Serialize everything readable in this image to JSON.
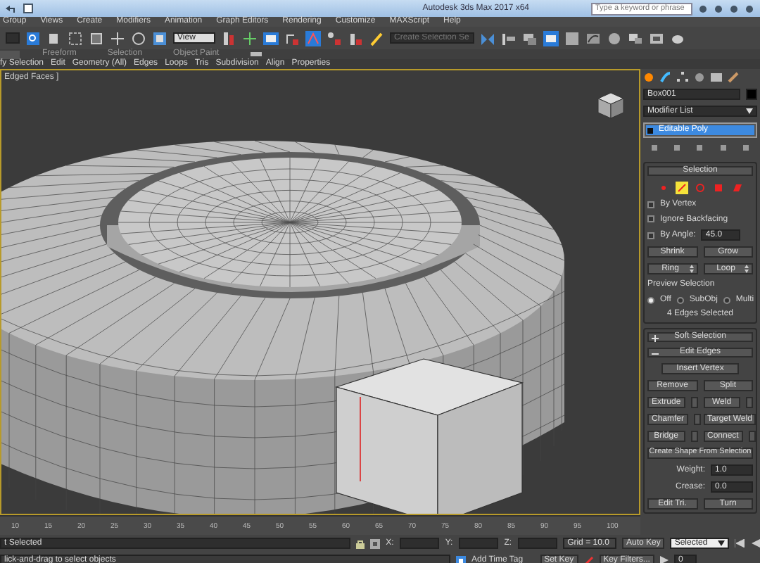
{
  "window": {
    "title": "Autodesk 3ds Max 2017 x64",
    "search_placeholder": "Type a keyword or phrase"
  },
  "menu": [
    "Group",
    "Views",
    "Create",
    "Modifiers",
    "Animation",
    "Graph Editors",
    "Rendering",
    "Customize",
    "MAXScript",
    "Help"
  ],
  "toolbar": {
    "view_dropdown": "View",
    "selection_set_placeholder": "Create Selection Se"
  },
  "ribbon_tabs": [
    {
      "label": "Freeform",
      "selected": false
    },
    {
      "label": "Selection",
      "selected": false
    },
    {
      "label": "Object Paint",
      "selected": false
    }
  ],
  "ribbon_panels": [
    "fy Selection",
    "Edit",
    "Geometry (All)",
    "Edges",
    "Loops",
    "Tris",
    "Subdivision",
    "Align",
    "Properties"
  ],
  "viewport": {
    "label": "Edged Faces ]"
  },
  "command_panel": {
    "object_name": "Box001",
    "modifier_list": "Modifier List",
    "stack": [
      {
        "label": "Editable Poly",
        "selected": true
      }
    ],
    "selection": {
      "title": "Selection",
      "subobject_levels": [
        {
          "kind": "vertex",
          "selected": false
        },
        {
          "kind": "edge",
          "selected": true
        },
        {
          "kind": "border",
          "selected": false
        },
        {
          "kind": "polygon",
          "selected": false
        },
        {
          "kind": "element",
          "selected": false
        }
      ],
      "checkboxes": [
        {
          "label": "By Vertex",
          "checked": false
        },
        {
          "label": "Ignore Backfacing",
          "checked": false
        },
        {
          "label": "By Angle:",
          "checked": false,
          "value": "45.0"
        }
      ],
      "buttons": [
        {
          "label": "Shrink",
          "kind": "plain"
        },
        {
          "label": "Grow",
          "kind": "plain"
        },
        {
          "label": "Ring",
          "kind": "spinner"
        },
        {
          "label": "Loop",
          "kind": "spinner"
        }
      ],
      "preview_title": "Preview Selection",
      "preview_options": [
        {
          "label": "Off",
          "selected": true
        },
        {
          "label": "SubObj",
          "selected": false
        },
        {
          "label": "Multi",
          "selected": false
        }
      ],
      "status": "4 Edges Selected"
    },
    "rollouts": [
      {
        "label": "Soft Selection",
        "expanded": false
      },
      {
        "label": "Edit Edges",
        "expanded": true
      }
    ],
    "edit_edges": {
      "insert": "Insert Vertex",
      "buttons": [
        {
          "label": "Remove",
          "settings": false
        },
        {
          "label": "Split",
          "settings": false
        },
        {
          "label": "Extrude",
          "settings": true
        },
        {
          "label": "Weld",
          "settings": true
        },
        {
          "label": "Chamfer",
          "settings": true
        },
        {
          "label": "Target Weld",
          "settings": false
        },
        {
          "label": "Bridge",
          "settings": true
        },
        {
          "label": "Connect",
          "settings": true
        }
      ],
      "create_shape": "Create Shape From Selection",
      "spinners": [
        {
          "label": "Weight:",
          "value": "1.0"
        },
        {
          "label": "Crease:",
          "value": "0.0"
        }
      ],
      "bottom": [
        "Edit Tri.",
        "Turn"
      ]
    }
  },
  "timeline": {
    "ticks": [
      "10",
      "15",
      "20",
      "25",
      "30",
      "35",
      "40",
      "45",
      "50",
      "55",
      "60",
      "65",
      "70",
      "75",
      "80",
      "85",
      "90",
      "95",
      "100"
    ]
  },
  "status": {
    "selection": "t Selected",
    "prompt": "lick-and-drag to select objects",
    "coords": [
      "X:",
      "Y:",
      "Z:"
    ],
    "grid": "Grid = 10.0",
    "add_time_tag": "Add Time Tag",
    "auto_key": "Auto Key",
    "key_mode": "Selected",
    "set_key": "Set Key",
    "key_filters": "Key Filters...",
    "frame": "0"
  }
}
